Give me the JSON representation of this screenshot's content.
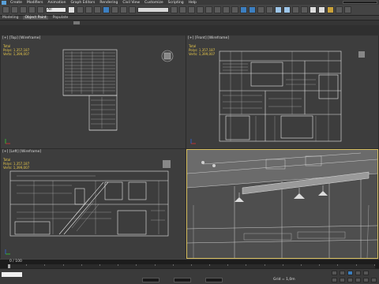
{
  "menu": [
    "Create",
    "Modifiers",
    "Animation",
    "Graph Editors",
    "Rendering",
    "Civil View",
    "Customize",
    "Scripting",
    "Help"
  ],
  "toolbar": {
    "selection_filter": "All"
  },
  "ribbon": {
    "tabs": [
      "Modeling",
      "Object Paint",
      "Populate"
    ],
    "active": "Object Paint"
  },
  "viewports": {
    "top": {
      "label": "[+] [Top] [Wireframe]",
      "stats": "Total\nPolys: 1,357,187\nVerts: 1,399,007"
    },
    "front": {
      "label": "[+] [Front] [Wireframe]",
      "stats": "Total\nPolys: 1,357,187\nVerts: 1,399,007"
    },
    "left": {
      "label": "[+] [Left] [Wireframe]",
      "stats": "Total\nPolys: 1,357,187\nVerts: 1,399,007"
    },
    "perspective": {
      "label": "[+] [Perspective] [Realistic]"
    }
  },
  "timeline": {
    "frame": "0 / 100"
  },
  "status": {
    "grid": "Grid = 1,0m"
  },
  "colors": {
    "viewport_bg": "#3d3d3d",
    "wire": "#e6e6e6",
    "stats": "#e8c84a",
    "active_border": "#d8c060"
  }
}
